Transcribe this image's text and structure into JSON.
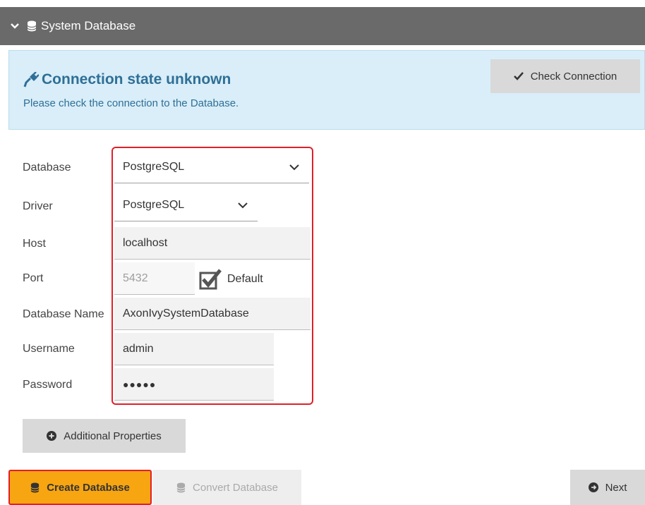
{
  "header": {
    "title": "System Database"
  },
  "connection": {
    "title": "Connection state unknown",
    "subtitle": "Please check the connection to the Database.",
    "check_label": "Check Connection"
  },
  "form": {
    "database_label": "Database",
    "database_value": "PostgreSQL",
    "driver_label": "Driver",
    "driver_value": "PostgreSQL",
    "host_label": "Host",
    "host_value": "localhost",
    "port_label": "Port",
    "port_placeholder": "5432",
    "default_label": "Default",
    "default_checked": true,
    "dbname_label": "Database Name",
    "dbname_value": "AxonIvySystemDatabase",
    "username_label": "Username",
    "username_value": "admin",
    "password_label": "Password",
    "password_value": "●●●●●"
  },
  "actions": {
    "additional_label": "Additional Properties",
    "create_label": "Create Database",
    "convert_label": "Convert Database",
    "next_label": "Next"
  },
  "colors": {
    "header_bg": "#6a6a6a",
    "info_bg": "#d9eef8",
    "info_text": "#2f6f97",
    "primary": "#f7a511",
    "highlight": "#e0202a"
  },
  "icons": [
    "chevron-down-icon",
    "database-icon",
    "plug-icon",
    "check-icon",
    "plus-circle-icon",
    "arrow-circle-right-icon",
    "checkbox-checked-icon"
  ]
}
